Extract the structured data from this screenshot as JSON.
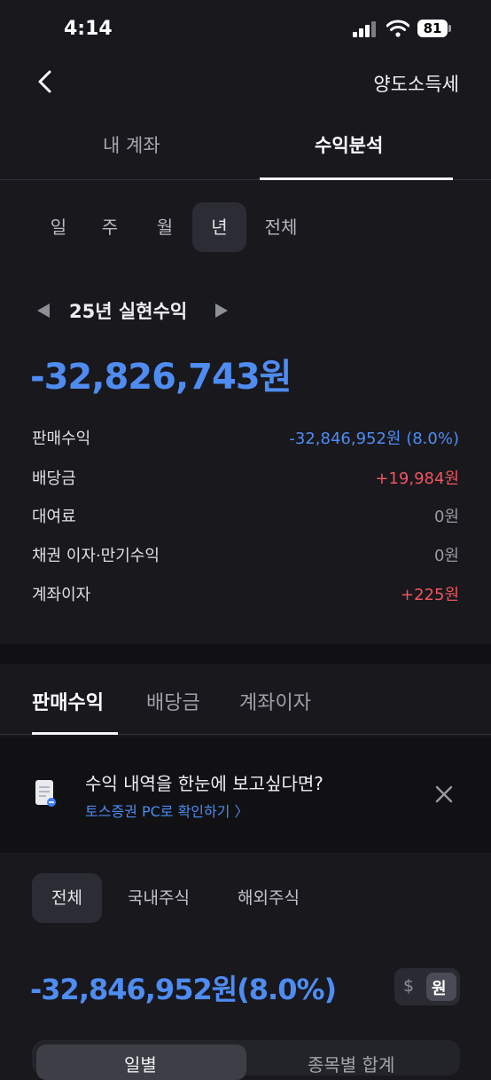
{
  "status_bar": {
    "time": "4:14",
    "battery": "81"
  },
  "header": {
    "title": "양도소득세"
  },
  "main_tabs": [
    {
      "label": "내 계좌"
    },
    {
      "label": "수익분석"
    }
  ],
  "periods": [
    "일",
    "주",
    "월",
    "년",
    "전체"
  ],
  "year": {
    "label": "25년 실현수익"
  },
  "total_profit": "-32,826,743원",
  "breakdown": [
    {
      "label": "판매수익",
      "value": "-32,846,952원 (8.0%)",
      "color": "#4f8cf2"
    },
    {
      "label": "배당금",
      "value": "+19,984원",
      "color": "#f0545f"
    },
    {
      "label": "대여료",
      "value": "0원",
      "color": "#9a9ca3"
    },
    {
      "label": "채권 이자·만기수익",
      "value": "0원",
      "color": "#9a9ca3"
    },
    {
      "label": "계좌이자",
      "value": "+225원",
      "color": "#f0545f"
    }
  ],
  "sub_tabs": [
    "판매수익",
    "배당금",
    "계좌이자"
  ],
  "banner": {
    "title": "수익 내역을 한눈에 보고싶다면?",
    "link": "토스증권 PC로 확인하기 〉"
  },
  "filters": [
    "전체",
    "국내주식",
    "해외주식"
  ],
  "sales_total": "-32,846,952원(8.0%)",
  "currency": {
    "dollar": "$",
    "won": "원"
  },
  "segments": [
    "일별",
    "종목별 합계"
  ]
}
